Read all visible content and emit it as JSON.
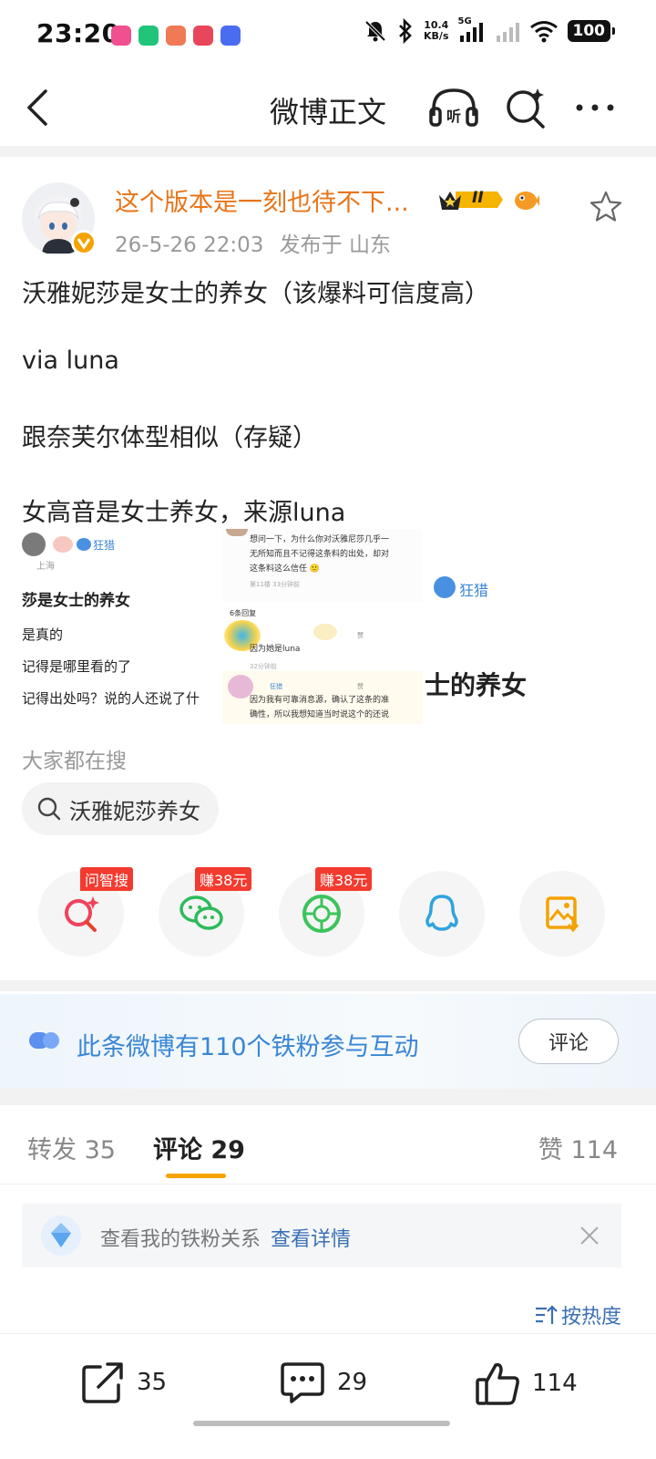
{
  "status_bar": {
    "time": "23:20",
    "net_speed_value": "10.4",
    "net_speed_unit": "KB/s",
    "network_type": "5G",
    "battery": "100",
    "icons": [
      "mute-bell-icon",
      "bluetooth-icon",
      "signal-icon",
      "wifi-icon"
    ]
  },
  "header": {
    "title": "微博正文"
  },
  "post": {
    "username": "这个版本是一刻也待不下...",
    "level_badge": "II",
    "date": "26-5-26 22:03",
    "location": "发布于 山东",
    "lines": [
      "沃雅妮莎是女士的养女（该爆料可信度高）",
      "via luna",
      "跟奈芙尔体型相似（存疑）",
      "女高音是女士养女，来源luna"
    ]
  },
  "images": {
    "left": {
      "loc": "上海",
      "tag": "狂猎",
      "title": "莎是女士的养女",
      "lines": [
        "是真的",
        "记得是哪里看的了",
        "记得出处吗？说的人还说了什"
      ]
    },
    "middle": {
      "q_line1": "想问一下，为什么你对沃雅尼莎几乎一",
      "q_line2": "无所知而且不记得这条料的出处，却对",
      "q_line3": "这条料这么信任 🙂",
      "q_meta": "第11楼 33分钟前",
      "replies_count": "6条回复",
      "reply1": "因为她是luna",
      "reply1_meta": "32分钟前",
      "reply2_tag": "狂猎",
      "reply2_line1": "因为我有可靠消息源，确认了这条的准",
      "reply2_line2": "确性，所以我想知道当时说这个的还说",
      "like_label": "赞"
    },
    "right": {
      "tag": "狂猎",
      "title": "士的养女"
    }
  },
  "search": {
    "label": "大家都在搜",
    "chip": "沃雅妮莎养女"
  },
  "share": {
    "items": [
      {
        "icon": "ai-search-icon",
        "tag": "问智搜"
      },
      {
        "icon": "wechat-icon",
        "tag": "赚38元"
      },
      {
        "icon": "moments-icon",
        "tag": "赚38元"
      },
      {
        "icon": "qq-icon",
        "tag": ""
      },
      {
        "icon": "save-image-icon",
        "tag": ""
      }
    ]
  },
  "fans_banner": {
    "text": "此条微博有110个铁粉参与互动",
    "button": "评论"
  },
  "tabs": {
    "repost": "转发 35",
    "comments": "评论 29",
    "likes": "赞 114"
  },
  "fans_relation": {
    "text": "查看我的铁粉关系",
    "link": "查看详情"
  },
  "sort": {
    "label": "按热度"
  },
  "bottom_bar": {
    "repost_count": "35",
    "comment_count": "29",
    "like_count": "114"
  },
  "colors": {
    "username": "#e8751a",
    "link_blue": "#3a86d4",
    "tab_underline": "#f5a300",
    "tag_red": "#f23b2f"
  }
}
